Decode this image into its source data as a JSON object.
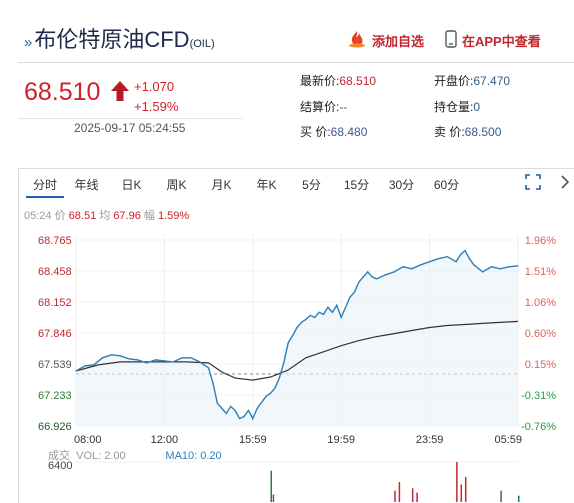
{
  "header": {
    "prefix": "»",
    "name": "布伦特原油CFD",
    "code": "(OIL)",
    "add_watchlist_label": "添加自选",
    "view_in_app_label": "在APP中查看"
  },
  "quote": {
    "price": "68.510",
    "change": "+1.070",
    "change_pct": "+1.59%",
    "timestamp": "2025-09-17 05:24:55",
    "direction": "up"
  },
  "stats": {
    "latest_label": "最新价:",
    "latest_value": "68.510",
    "open_label": "开盘价:",
    "open_value": "67.470",
    "settle_label": "结算价:",
    "settle_value": "--",
    "oi_label": "持仓量:",
    "oi_value": "0",
    "bid_label": "买  价:",
    "bid_value": "68.480",
    "ask_label": "卖  价:",
    "ask_value": "68.500"
  },
  "tabs": [
    "分时",
    "年线",
    "日K",
    "周K",
    "月K",
    "年K",
    "5分",
    "15分",
    "30分",
    "60分"
  ],
  "info_bar": {
    "time": "05:24",
    "price_label": "价",
    "price": "68.51",
    "avg_label": "均",
    "avg": "67.96",
    "pct_label": "幅",
    "pct": "1.59%"
  },
  "volume": {
    "label": "成交",
    "vol_label": "VOL: 2.00",
    "ma_label": "MA10: 0.20",
    "max": "6400"
  },
  "colors": {
    "up": "#d0202a",
    "down": "#1f8a3b",
    "price_line": "#2c7fb8",
    "avg_line": "#333333",
    "accent": "#1d5fb0"
  },
  "icons": {
    "add_watchlist": "flame-icon",
    "view_in_app": "phone-icon",
    "expand": "expand-icon",
    "more": "chevron-right-icon"
  },
  "chart_data": {
    "type": "line",
    "prev_close": 67.44,
    "y_ticks_left": [
      "68.765",
      "68.458",
      "68.152",
      "67.846",
      "67.539",
      "67.233",
      "66.926"
    ],
    "y_ticks_right": [
      "1.96%",
      "1.51%",
      "1.06%",
      "0.60%",
      "0.15%",
      "-0.31%",
      "-0.76%"
    ],
    "x_ticks": [
      "08:00",
      "12:00",
      "15:59",
      "19:59",
      "23:59",
      "05:59"
    ],
    "ylim": [
      66.926,
      68.765
    ],
    "series": [
      {
        "x": [
          0.0,
          0.02,
          0.04,
          0.06,
          0.08,
          0.1,
          0.12,
          0.14,
          0.16,
          0.18,
          0.2,
          0.22,
          0.24,
          0.26,
          0.28,
          0.3,
          0.31,
          0.32,
          0.33,
          0.34,
          0.35,
          0.36,
          0.37,
          0.38,
          0.39,
          0.4,
          0.41,
          0.42,
          0.43,
          0.44,
          0.45,
          0.46,
          0.47,
          0.48,
          0.49,
          0.5,
          0.51,
          0.52,
          0.53,
          0.54,
          0.55,
          0.56,
          0.57,
          0.58,
          0.59,
          0.6,
          0.62,
          0.63,
          0.64,
          0.65,
          0.66,
          0.67,
          0.68,
          0.7,
          0.72,
          0.74,
          0.76,
          0.78,
          0.8,
          0.82,
          0.84,
          0.86,
          0.87,
          0.88,
          0.89,
          0.9,
          0.92,
          0.94,
          0.96,
          0.98,
          1.0
        ],
        "values": [
          67.47,
          67.52,
          67.53,
          67.6,
          67.63,
          67.62,
          67.59,
          67.58,
          67.55,
          67.58,
          67.57,
          67.56,
          67.6,
          67.6,
          67.56,
          67.5,
          67.35,
          67.15,
          67.1,
          67.05,
          67.12,
          67.08,
          67.0,
          67.02,
          67.08,
          67.0,
          67.1,
          67.16,
          67.22,
          67.25,
          67.3,
          67.4,
          67.55,
          67.75,
          67.82,
          67.9,
          67.95,
          67.98,
          68.02,
          68.0,
          68.05,
          68.03,
          68.1,
          68.05,
          68.12,
          68.0,
          68.2,
          68.25,
          68.35,
          68.4,
          68.45,
          68.4,
          68.38,
          68.42,
          68.45,
          68.5,
          68.48,
          68.52,
          68.55,
          68.58,
          68.6,
          68.55,
          68.62,
          68.66,
          68.58,
          68.52,
          68.45,
          68.5,
          68.48,
          68.5,
          68.51
        ]
      },
      {
        "x": [
          0.0,
          0.05,
          0.1,
          0.15,
          0.2,
          0.25,
          0.3,
          0.33,
          0.36,
          0.4,
          0.44,
          0.48,
          0.52,
          0.56,
          0.6,
          0.64,
          0.68,
          0.72,
          0.76,
          0.8,
          0.84,
          0.88,
          0.92,
          0.96,
          1.0
        ],
        "values": [
          67.47,
          67.53,
          67.56,
          67.56,
          67.56,
          67.56,
          67.55,
          67.46,
          67.4,
          67.38,
          67.41,
          67.48,
          67.6,
          67.66,
          67.72,
          67.77,
          67.81,
          67.84,
          67.87,
          67.9,
          67.92,
          67.93,
          67.94,
          67.95,
          67.96
        ]
      }
    ],
    "volume_bars": [
      {
        "x": 0.44,
        "value": 5000
      },
      {
        "x": 0.445,
        "value": 1200
      },
      {
        "x": 0.72,
        "value": 1800
      },
      {
        "x": 0.73,
        "value": 3200
      },
      {
        "x": 0.76,
        "value": 2200
      },
      {
        "x": 0.77,
        "value": 1500
      },
      {
        "x": 0.86,
        "value": 6400
      },
      {
        "x": 0.87,
        "value": 2800
      },
      {
        "x": 0.88,
        "value": 4000
      },
      {
        "x": 0.96,
        "value": 1800
      },
      {
        "x": 1.0,
        "value": 1000
      }
    ]
  }
}
